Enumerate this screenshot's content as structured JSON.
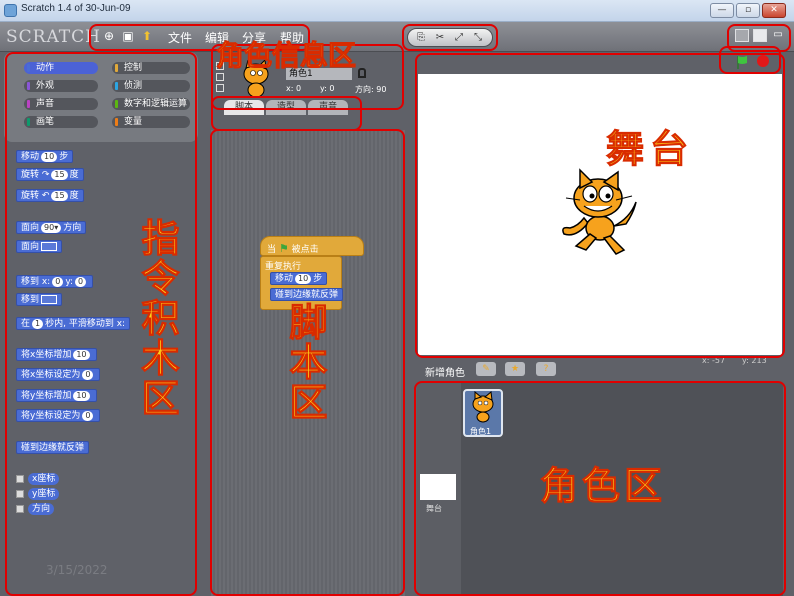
{
  "window": {
    "title": "Scratch 1.4 of 30-Jun-09",
    "buttons": {
      "minimize": "—",
      "restore": "▫",
      "close": "✕"
    }
  },
  "menubar": {
    "logo": "SCRATCH",
    "icons": [
      "globe-icon",
      "save-icon",
      "share-icon"
    ],
    "items": [
      "文件",
      "编辑",
      "分享",
      "帮助"
    ]
  },
  "categories": [
    {
      "label": "动作",
      "color": "#4a6cd4"
    },
    {
      "label": "控制",
      "color": "#e1a93a"
    },
    {
      "label": "外观",
      "color": "#8a55d7"
    },
    {
      "label": "侦测",
      "color": "#2ca5e2"
    },
    {
      "label": "声音",
      "color": "#bb42c3"
    },
    {
      "label": "数字和逻辑运算",
      "color": "#5cb712"
    },
    {
      "label": "画笔",
      "color": "#0e9a6c"
    },
    {
      "label": "变量",
      "color": "#ee7d16"
    }
  ],
  "palette_blocks": {
    "move": {
      "pre": "移动",
      "num": "10",
      "post": "步"
    },
    "turn_right": {
      "pre": "旋转 ↷",
      "num": "15",
      "post": "度"
    },
    "turn_left": {
      "pre": "旋转 ↶",
      "num": "15",
      "post": "度"
    },
    "point_dir": {
      "pre": "面向",
      "num": "90▾",
      "post": "方向"
    },
    "point_towards": {
      "pre": "面向"
    },
    "goto_xy": {
      "pre": "移到 x:",
      "x": "0",
      "mid": "y:",
      "y": "0"
    },
    "goto": {
      "pre": "移到"
    },
    "glide": {
      "pre": "在",
      "num": "1",
      "post": "秒内, 平滑移动到 x:"
    },
    "change_x": {
      "pre": "将x坐标增加",
      "num": "10"
    },
    "set_x": {
      "pre": "将x坐标设定为",
      "num": "0"
    },
    "change_y": {
      "pre": "将y坐标增加",
      "num": "10"
    },
    "set_y": {
      "pre": "将y坐标设定为",
      "num": "0"
    },
    "bounce": "碰到边缘就反弹",
    "reporters": [
      "x座标",
      "y座标",
      "方向"
    ]
  },
  "watermark": "3/15/2022",
  "sprite_info": {
    "name": "角色1",
    "x_label": "x:",
    "x": "0",
    "y_label": "y:",
    "y": "0",
    "dir_label": "方向:",
    "dir": "90"
  },
  "tabs": [
    "脚本",
    "造型",
    "声音"
  ],
  "script": {
    "hat_pre": "当",
    "hat_post": "被点击",
    "forever": "重复执行",
    "move_pre": "移动",
    "move_num": "10",
    "move_post": "步",
    "bounce": "碰到边缘就反弹"
  },
  "stage": {
    "mouse_x_label": "x:",
    "mouse_x": "-57",
    "mouse_y_label": "y:",
    "mouse_y": "213"
  },
  "sprite_list": {
    "new_sprite_label": "新增角色",
    "sprite_label": "角色1",
    "stage_label": "舞台"
  },
  "annotations": {
    "role_info": "角色信息区",
    "stage": "舞台",
    "palette": "指令积木区",
    "scripts": "脚本区",
    "sprites": "角色区"
  }
}
